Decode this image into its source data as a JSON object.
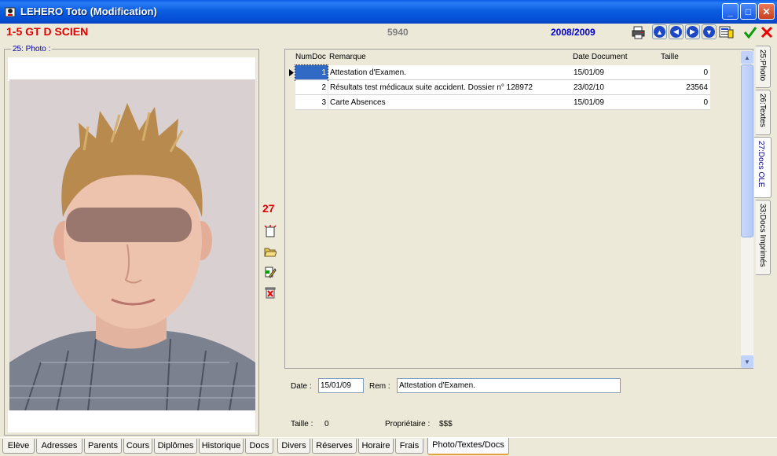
{
  "window": {
    "title": "LEHERO Toto (Modification)",
    "icon": "app-icon",
    "controls": {
      "minimize": "_",
      "maximize": "□",
      "close": "✕"
    }
  },
  "toolbar": {
    "class_label": "1-5 GT D SCIEN",
    "id": "5940",
    "school_year": "2008/2009",
    "buttons": [
      "print-icon",
      "arrow-up-icon",
      "arrow-left-icon",
      "arrow-right-icon",
      "arrow-down-icon",
      "list-icon",
      "checkmark-icon",
      "cancel-icon"
    ]
  },
  "photo_panel": {
    "legend": "25: Photo :"
  },
  "docs": {
    "count": "27",
    "side_icons": [
      "new-doc-icon",
      "open-folder-icon",
      "edit-doc-icon",
      "delete-doc-icon"
    ],
    "columns": {
      "num": "NumDoc",
      "remark": "Remarque",
      "date": "Date Document",
      "size": "Taille"
    },
    "rows": [
      {
        "num": "1",
        "remark": "Attestation d'Examen.",
        "date": "15/01/09",
        "size": "0"
      },
      {
        "num": "2",
        "remark": "Résultats test médicaux suite accident. Dossier n° 128972",
        "date": "23/02/10",
        "size": "23564"
      },
      {
        "num": "3",
        "remark": "Carte Absences",
        "date": "15/01/09",
        "size": "0"
      }
    ],
    "selected_row": 0
  },
  "detail": {
    "date_label": "Date :",
    "date_value": "15/01/09",
    "rem_label": "Rem :",
    "rem_value": "Attestation d'Examen.",
    "size_label": "Taille :",
    "size_value": "0",
    "owner_label": "Propriétaire :",
    "owner_value": "$$$"
  },
  "side_tabs": [
    {
      "label": "25:Photo"
    },
    {
      "label": "26:Textes"
    },
    {
      "label": "27:Docs OLE"
    },
    {
      "label": "33:Docs Imprimés"
    }
  ],
  "active_side_tab": "27:Docs OLE",
  "bottom_tabs": [
    {
      "label": "Elève"
    },
    {
      "label": "Adresses"
    },
    {
      "label": "Parents"
    },
    {
      "label": "Cours"
    },
    {
      "label": "Diplômes"
    },
    {
      "label": "Historique"
    },
    {
      "label": "Docs"
    },
    {
      "label": "Divers"
    },
    {
      "label": "Réserves"
    },
    {
      "label": "Horaire"
    },
    {
      "label": "Frais"
    },
    {
      "label": "Photo/Textes/Docs"
    }
  ],
  "active_bottom_tab": "Photo/Textes/Docs",
  "colors": {
    "titlebar": "#0550d6",
    "class_label": "#e00000",
    "year_label": "#0000c8",
    "count": "#e00000",
    "selection": "#316ac5",
    "window_bg": "#ece9d8"
  }
}
